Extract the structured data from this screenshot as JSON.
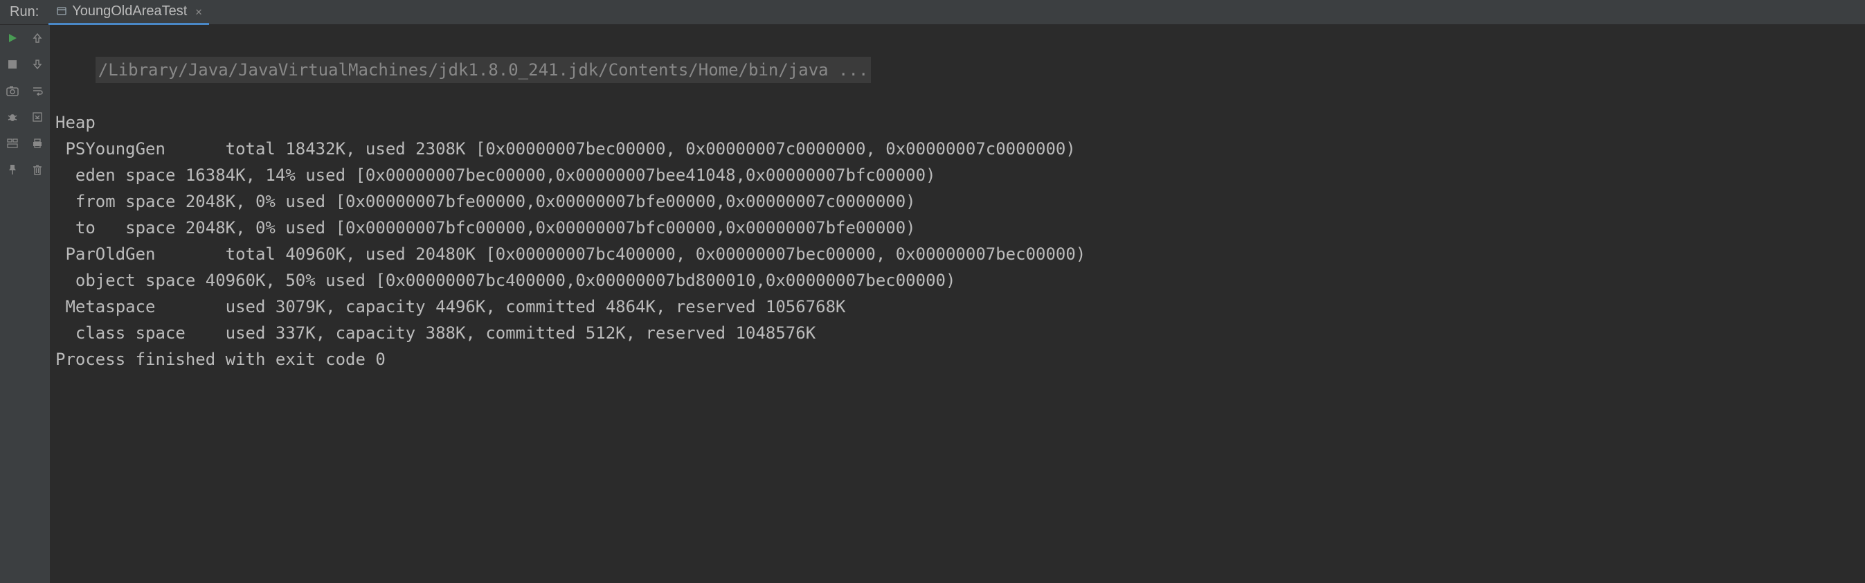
{
  "header": {
    "run_label": "Run:",
    "tab_name": "YoungOldAreaTest"
  },
  "console": {
    "cmd": "/Library/Java/JavaVirtualMachines/jdk1.8.0_241.jdk/Contents/Home/bin/java ...",
    "lines": [
      "Heap",
      " PSYoungGen      total 18432K, used 2308K [0x00000007bec00000, 0x00000007c0000000, 0x00000007c0000000)",
      "  eden space 16384K, 14% used [0x00000007bec00000,0x00000007bee41048,0x00000007bfc00000)",
      "  from space 2048K, 0% used [0x00000007bfe00000,0x00000007bfe00000,0x00000007c0000000)",
      "  to   space 2048K, 0% used [0x00000007bfc00000,0x00000007bfc00000,0x00000007bfe00000)",
      " ParOldGen       total 40960K, used 20480K [0x00000007bc400000, 0x00000007bec00000, 0x00000007bec00000)",
      "  object space 40960K, 50% used [0x00000007bc400000,0x00000007bd800010,0x00000007bec00000)",
      " Metaspace       used 3079K, capacity 4496K, committed 4864K, reserved 1056768K",
      "  class space    used 337K, capacity 388K, committed 512K, reserved 1048576K",
      "",
      "Process finished with exit code 0"
    ]
  }
}
